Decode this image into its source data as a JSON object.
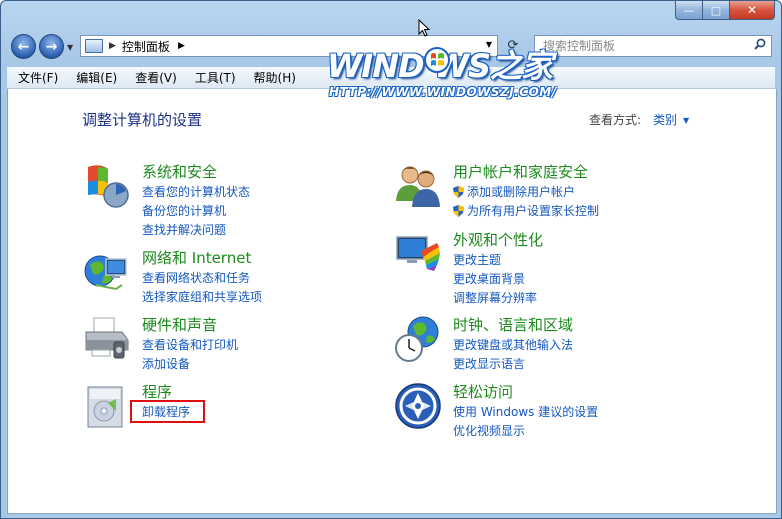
{
  "window": {
    "min_glyph": "—",
    "max_glyph": "□",
    "close_glyph": "✕"
  },
  "address": {
    "path": "控制面板",
    "refresh_glyph": "⟳"
  },
  "search": {
    "placeholder": "搜索控制面板"
  },
  "watermark": {
    "logo_text": "WIND   WS之家",
    "url": "HTTP://WWW.WINDOWSZJ.COM/"
  },
  "menu": {
    "items": [
      "文件(F)",
      "编辑(E)",
      "查看(V)",
      "工具(T)",
      "帮助(H)"
    ]
  },
  "main": {
    "title": "调整计算机的设置",
    "view_label": "查看方式:",
    "view_value": "类别"
  },
  "categories": [
    {
      "title": "系统和安全",
      "links": [
        "查看您的计算机状态",
        "备份您的计算机",
        "查找并解决问题"
      ]
    },
    {
      "title": "网络和 Internet",
      "links": [
        "查看网络状态和任务",
        "选择家庭组和共享选项"
      ]
    },
    {
      "title": "硬件和声音",
      "links": [
        "查看设备和打印机",
        "添加设备"
      ]
    },
    {
      "title": "程序",
      "links": [
        "卸载程序"
      ]
    },
    {
      "title": "用户帐户和家庭安全",
      "links": [
        "添加或删除用户帐户",
        "为所有用户设置家长控制"
      ]
    },
    {
      "title": "外观和个性化",
      "links": [
        "更改主题",
        "更改桌面背景",
        "调整屏幕分辨率"
      ]
    },
    {
      "title": "时钟、语言和区域",
      "links": [
        "更改键盘或其他输入法",
        "更改显示语言"
      ]
    },
    {
      "title": "轻松访问",
      "links": [
        "使用 Windows 建议的设置",
        "优化视频显示"
      ]
    }
  ],
  "colors": {
    "category_title": "#1c8a1c",
    "link": "#1558c0",
    "page_title": "#1e3287",
    "highlight_box": "#e01010"
  }
}
